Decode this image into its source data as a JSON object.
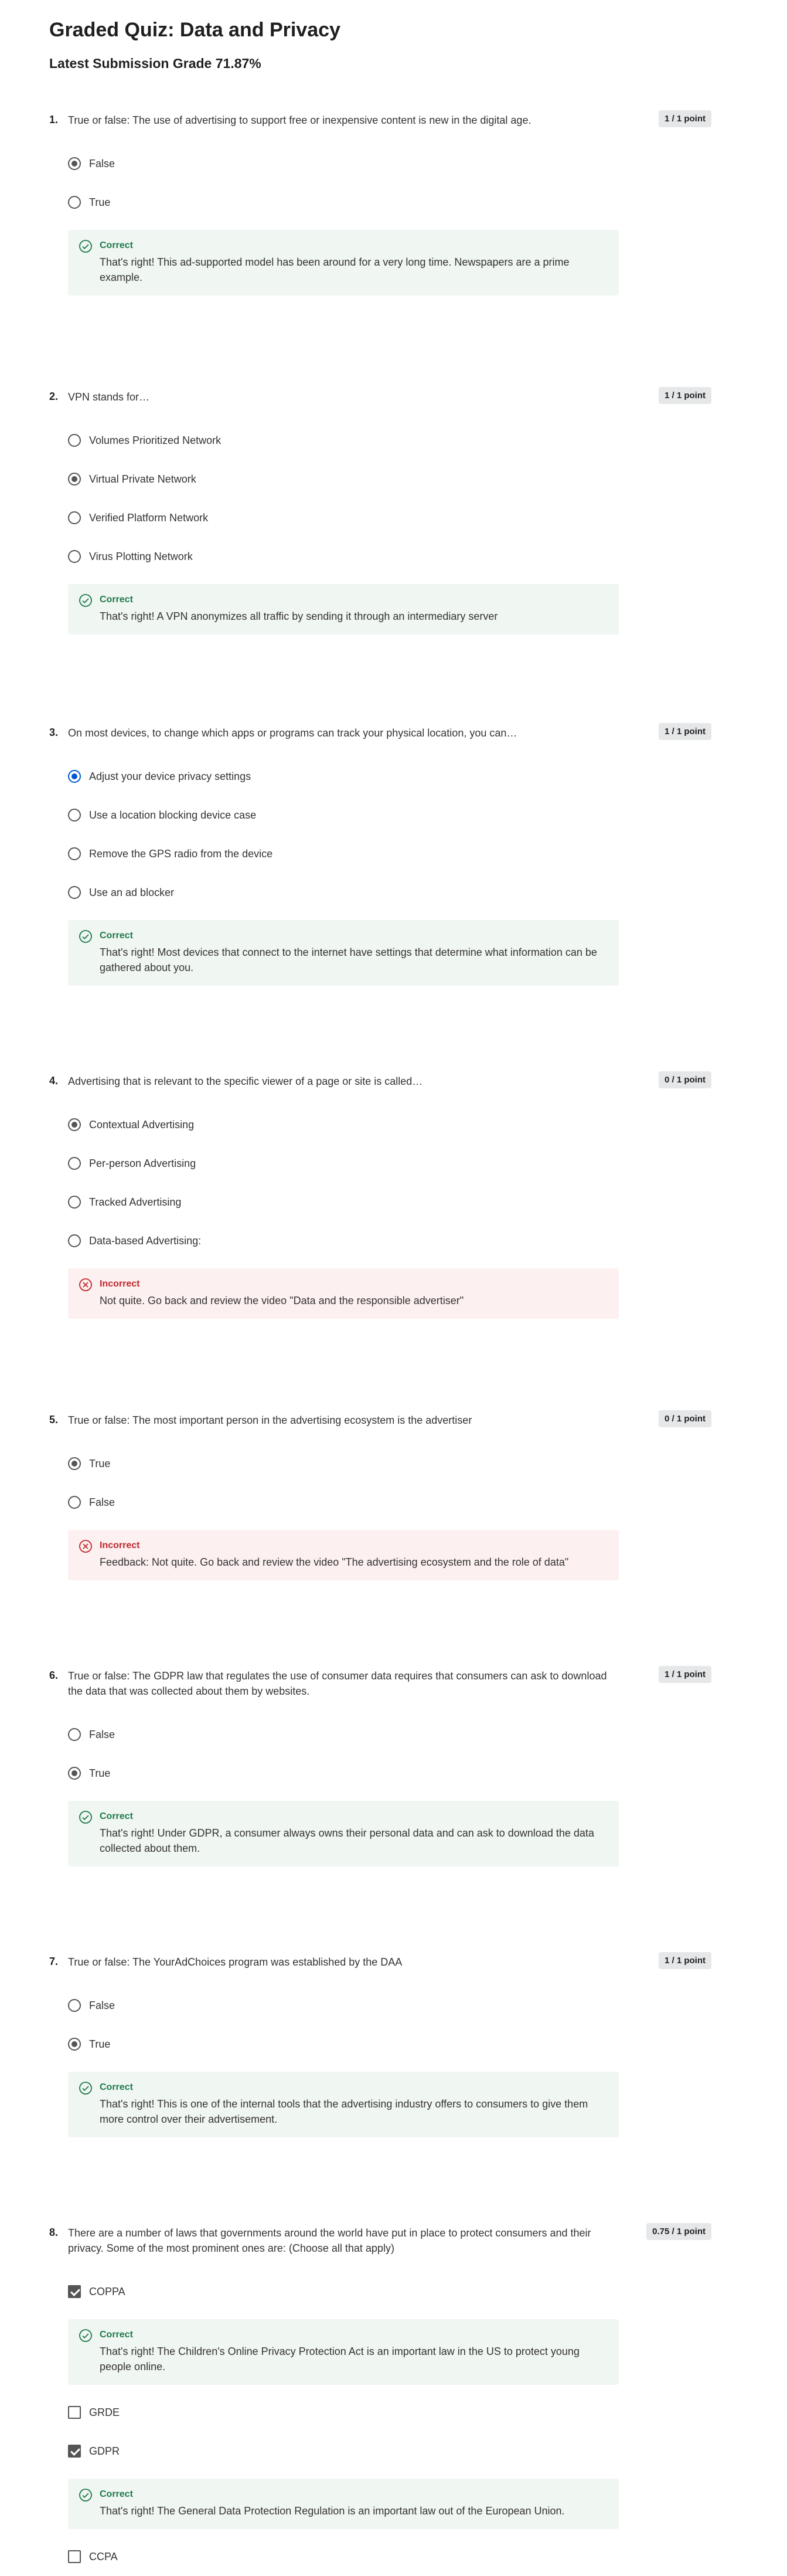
{
  "page": {
    "title": "Graded Quiz: Data and Privacy",
    "grade": "Latest Submission Grade 71.87%"
  },
  "colors": {
    "correct": "#1e7a4b",
    "incorrect": "#c1272d",
    "selected_blue": "#0056d2"
  },
  "questions": [
    {
      "num": "1.",
      "text": "True or false: The use of advertising to support free or inexpensive content is new in the digital age.",
      "points": "1 / 1 point",
      "options": [
        {
          "label": "False",
          "selected": true
        },
        {
          "label": "True",
          "selected": false
        }
      ],
      "feedback": {
        "type": "correct",
        "label": "Correct",
        "text": "That's right! This ad-supported model has been around for a very long time. Newspapers are a prime example."
      }
    },
    {
      "num": "2.",
      "text": "VPN stands for…",
      "points": "1 / 1 point",
      "options": [
        {
          "label": "Volumes Prioritized Network",
          "selected": false
        },
        {
          "label": "Virtual Private Network",
          "selected": true
        },
        {
          "label": "Verified Platform Network",
          "selected": false
        },
        {
          "label": "Virus Plotting Network",
          "selected": false
        }
      ],
      "feedback": {
        "type": "correct",
        "label": "Correct",
        "text": "That's right! A VPN anonymizes all traffic by sending it through an intermediary server"
      }
    },
    {
      "num": "3.",
      "text": "On most devices, to change which apps or programs can track your physical location, you can…",
      "points": "1 / 1 point",
      "options": [
        {
          "label": "Adjust your device privacy settings",
          "selected": true
        },
        {
          "label": "Use a location blocking device case",
          "selected": false
        },
        {
          "label": "Remove the GPS radio from the device",
          "selected": false
        },
        {
          "label": "Use an ad blocker",
          "selected": false
        }
      ],
      "feedback": {
        "type": "correct",
        "label": "Correct",
        "text": "That's right! Most devices that connect to the internet have settings that determine what information can be gathered about you."
      }
    },
    {
      "num": "4.",
      "text": "Advertising that is relevant to the specific viewer of a page or site is called…",
      "points": "0 / 1 point",
      "options": [
        {
          "label": "Contextual Advertising",
          "selected": true
        },
        {
          "label": "Per-person Advertising",
          "selected": false
        },
        {
          "label": "Tracked Advertising",
          "selected": false
        },
        {
          "label": "Data-based Advertising:",
          "selected": false
        }
      ],
      "feedback": {
        "type": "incorrect",
        "label": "Incorrect",
        "text": "Not quite. Go back and review the video \"Data and the responsible advertiser\""
      }
    },
    {
      "num": "5.",
      "text": "True or false: The most important person in the advertising ecosystem   is the advertiser",
      "points": "0 / 1 point",
      "options": [
        {
          "label": "True",
          "selected": true
        },
        {
          "label": "False",
          "selected": false
        }
      ],
      "feedback": {
        "type": "incorrect",
        "label": "Incorrect",
        "text": "Feedback: Not quite. Go back and review the video \"The advertising ecosystem and the role of data\""
      }
    },
    {
      "num": "6.",
      "text": "True or false: The GDPR law that regulates the use of consumer data requires that consumers can ask to download the data that was collected about them by websites.",
      "points": "1 / 1 point",
      "options": [
        {
          "label": "False",
          "selected": false
        },
        {
          "label": "True",
          "selected": true
        }
      ],
      "feedback": {
        "type": "correct",
        "label": "Correct",
        "text": "That's right! Under GDPR, a consumer always owns their personal data and can ask to download the data collected about them."
      }
    },
    {
      "num": "7.",
      "text": "True or false: The YourAdChoices program was established by the DAA",
      "points": "1 / 1 point",
      "options": [
        {
          "label": "False",
          "selected": false
        },
        {
          "label": "True",
          "selected": true
        }
      ],
      "feedback": {
        "type": "correct",
        "label": "Correct",
        "text": "That's right! This is one of the internal tools that the advertising industry offers to consumers to give them more control over their advertisement."
      }
    }
  ],
  "q8": {
    "num": "8.",
    "text": "There are a number of laws that governments around the world have put in place to protect consumers and their privacy. Some of the most prominent ones are: (Choose all that apply)",
    "points": "0.75 / 1 point",
    "items": [
      {
        "label": "COPPA",
        "checked": true,
        "feedback": {
          "label": "Correct",
          "text": "That's right! The Children's Online Privacy Protection Act is an important law in the US to protect young people online."
        }
      },
      {
        "label": "GRDE",
        "checked": false
      },
      {
        "label": "GDPR",
        "checked": true,
        "feedback": {
          "label": "Correct",
          "text": "That's right! The General Data Protection Regulation is an important law out of the European Union."
        }
      },
      {
        "label": "CCPA",
        "checked": false
      }
    ]
  }
}
